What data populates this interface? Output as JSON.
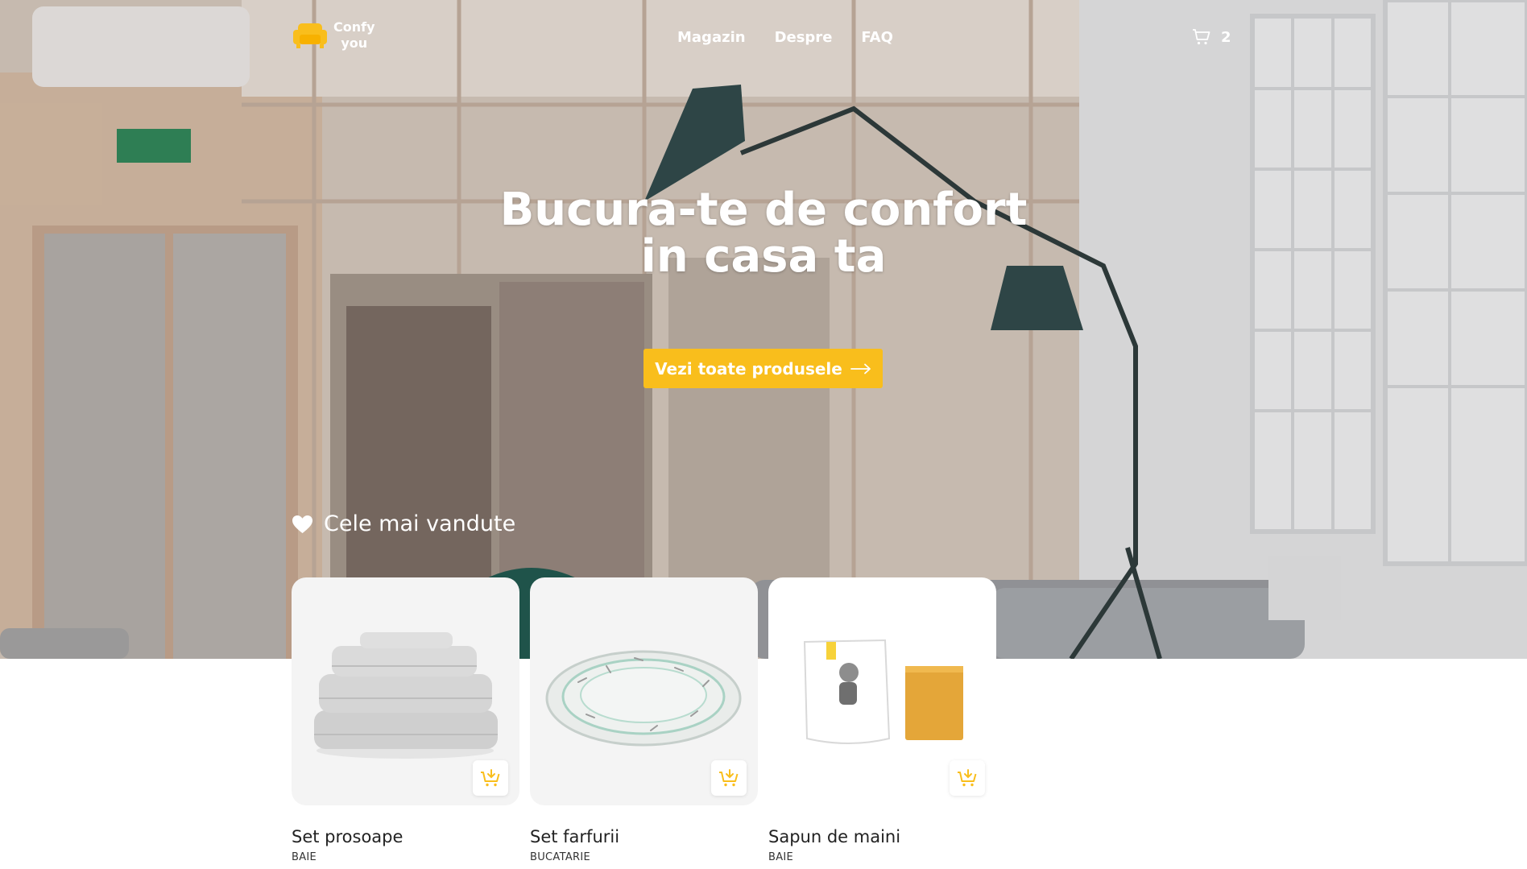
{
  "brand": {
    "line1": "Confy",
    "line2": "you",
    "accent": "#f9be1c"
  },
  "nav": {
    "items": [
      "Magazin",
      "Despre",
      "FAQ"
    ]
  },
  "cart": {
    "count": "2"
  },
  "hero": {
    "title_line1": "Bucura-te de confort",
    "title_line2": "in casa ta",
    "cta_label": "Vezi toate produsele"
  },
  "bestsellers": {
    "title": "Cele mai vandute"
  },
  "products": [
    {
      "name": "Set prosoape",
      "category": "BAIE"
    },
    {
      "name": "Set farfurii",
      "category": "BUCATARIE"
    },
    {
      "name": "Sapun de maini",
      "category": "BAIE"
    }
  ],
  "icons": {
    "logo": "sofa-icon",
    "cart": "shopping-cart-icon",
    "cta": "arrow-right-icon",
    "bestsellers": "heart-icon",
    "add": "add-to-cart-icon"
  }
}
